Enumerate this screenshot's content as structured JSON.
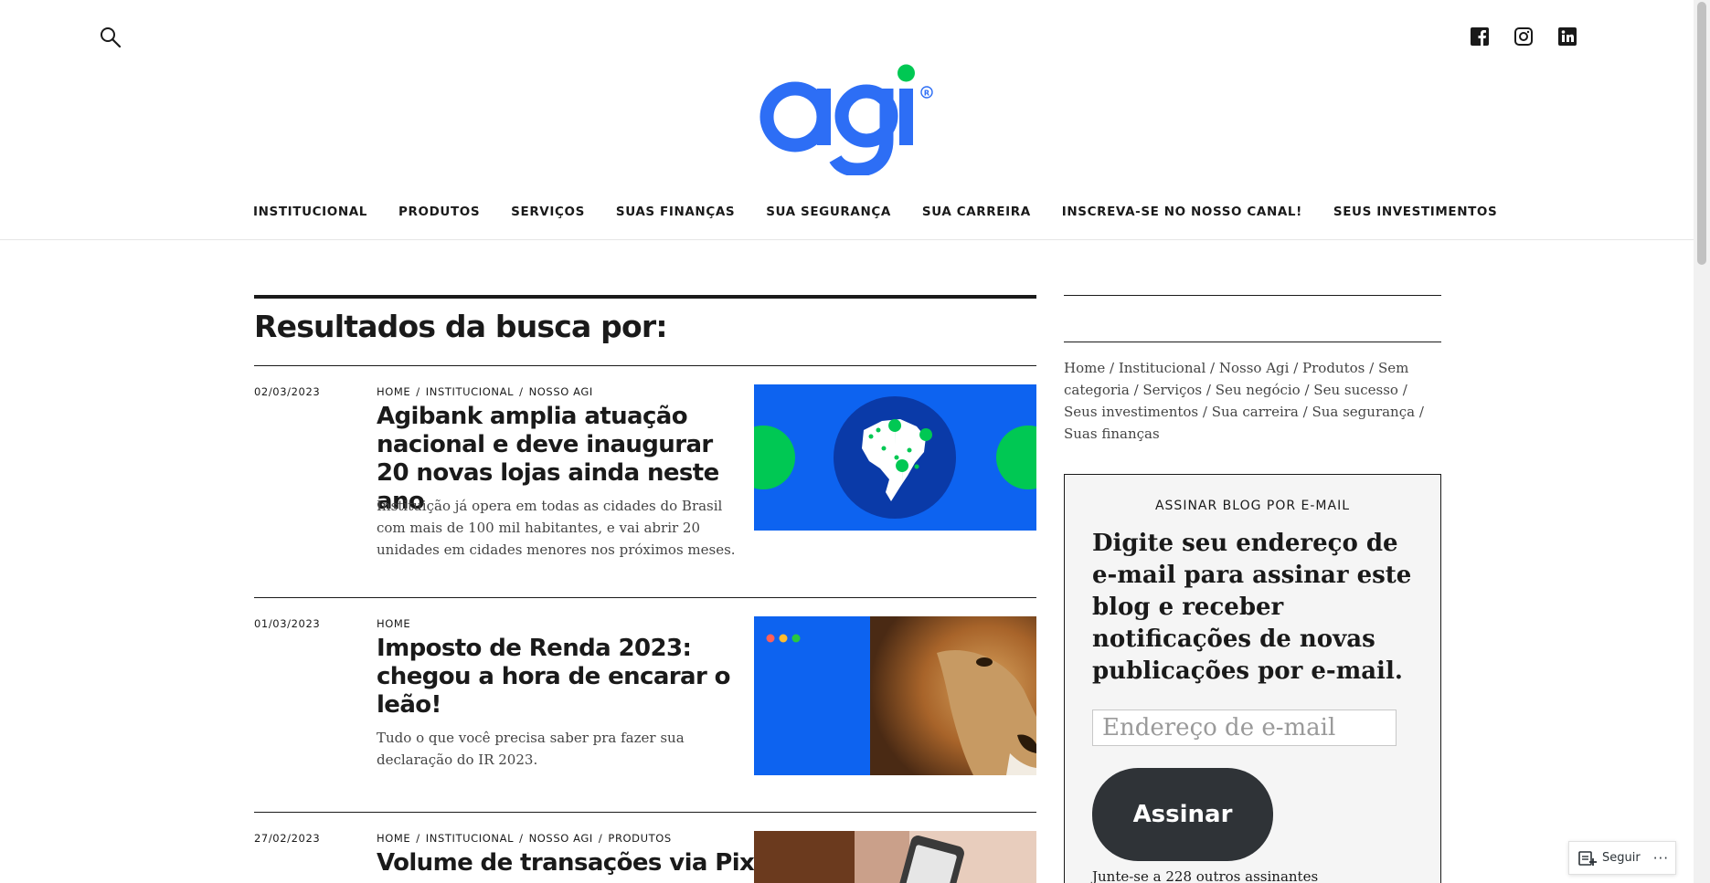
{
  "header": {
    "logo_text": "agi",
    "nav": [
      "INSTITUCIONAL",
      "PRODUTOS",
      "SERVIÇOS",
      "SUAS FINANÇAS",
      "SUA SEGURANÇA",
      "SUA CARREIRA",
      "INSCREVA-SE NO NOSSO CANAL!",
      "SEUS INVESTIMENTOS"
    ],
    "social": [
      "facebook-icon",
      "instagram-icon",
      "linkedin-icon"
    ]
  },
  "main": {
    "page_title": "Resultados da busca por:",
    "posts": [
      {
        "date": "02/03/2023",
        "cats": [
          "HOME",
          "INSTITUCIONAL",
          "NOSSO AGI"
        ],
        "title": "Agibank amplia atuação nacional e deve inaugurar 20 novas lojas ainda neste ano",
        "excerpt": "Instituição já opera em todas as cidades do Brasil com mais de 100 mil habitantes, e vai abrir 20 unidades em cidades menores nos próximos meses."
      },
      {
        "date": "01/03/2023",
        "cats": [
          "HOME"
        ],
        "title": "Imposto de Renda 2023: chegou a hora de encarar o leão!",
        "excerpt": "Tudo o que você precisa saber pra fazer sua declaração do IR 2023."
      },
      {
        "date": "27/02/2023",
        "cats": [
          "HOME",
          "INSTITUCIONAL",
          "NOSSO AGI",
          "PRODUTOS"
        ],
        "title": "Volume de transações via Pix",
        "excerpt": ""
      }
    ]
  },
  "sidebar": {
    "categories": [
      "Home",
      "Institucional",
      "Nosso Agi",
      "Produtos",
      "Sem categoria",
      "Serviços",
      "Seu negócio",
      "Seu sucesso",
      "Seus investimentos",
      "Sua carreira",
      "Sua segurança",
      "Suas finanças"
    ],
    "subscribe": {
      "title": "ASSINAR BLOG POR E-MAIL",
      "description": "Digite seu endereço de e-mail para assinar este blog e receber notificações de novas publicações por e-mail.",
      "email_placeholder": "Endereço de e-mail",
      "button": "Assinar",
      "count_text": "Junte-se a 228 outros assinantes"
    }
  },
  "follow_widget": {
    "label": "Seguir",
    "more": "···"
  },
  "colors": {
    "brand_blue": "#2d6ef5",
    "brand_green": "#00c853",
    "button_dark": "#2f3337"
  }
}
